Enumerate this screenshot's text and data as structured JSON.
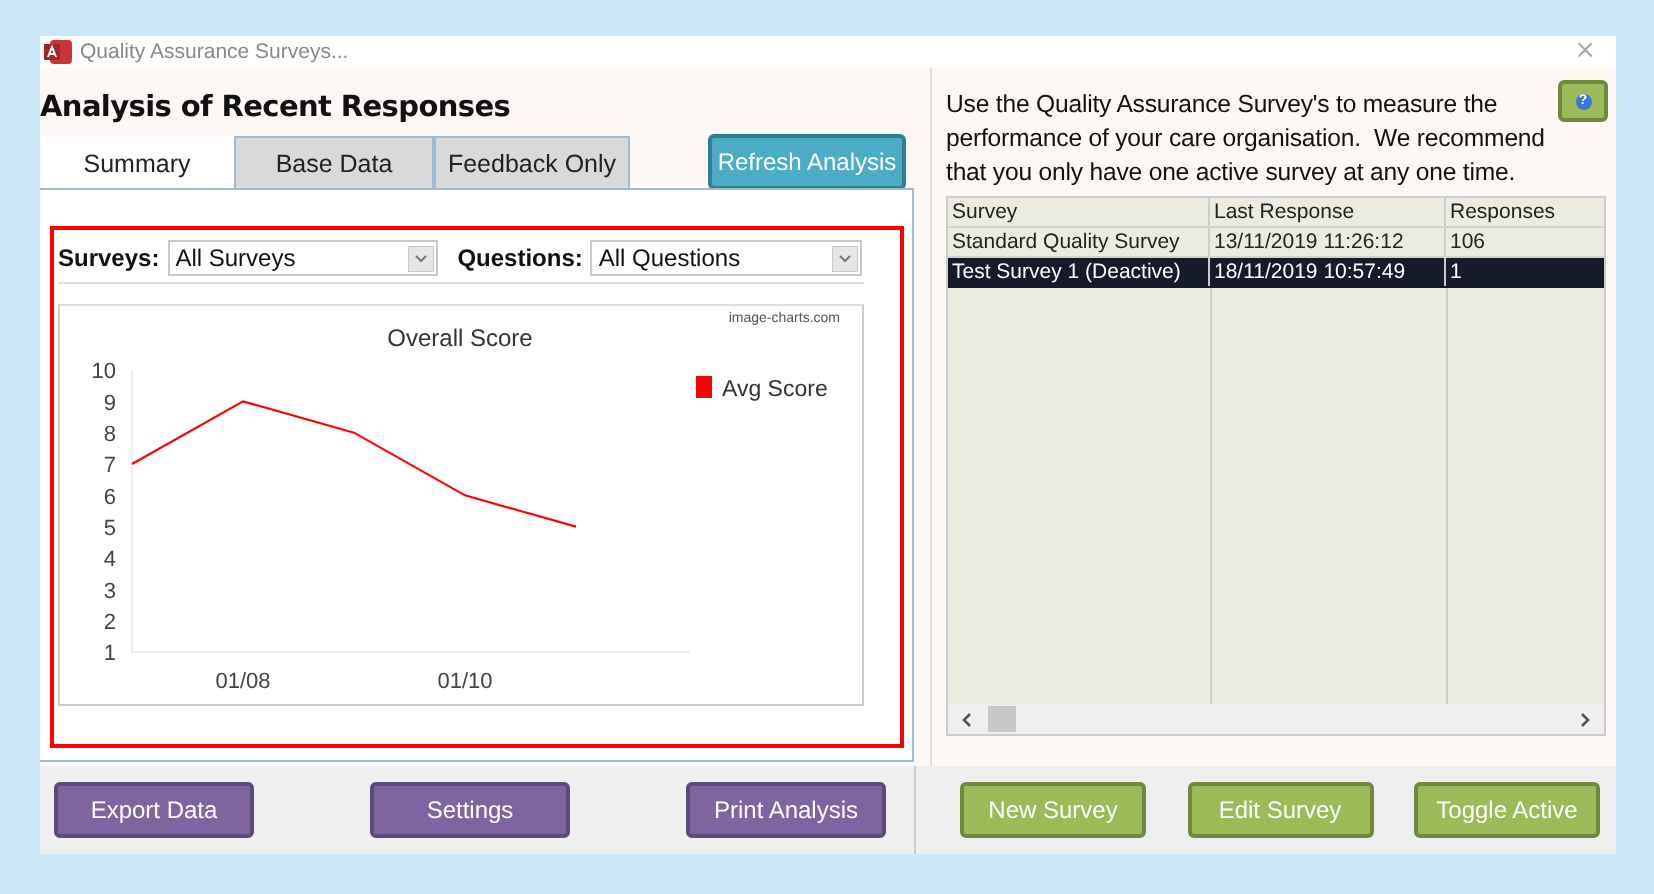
{
  "window": {
    "title": "Quality Assurance Surveys...",
    "close": "×"
  },
  "analysis": {
    "heading": "Analysis of Recent Responses",
    "tabs": [
      {
        "label": "Summary",
        "selected": true
      },
      {
        "label": "Base Data",
        "selected": false
      },
      {
        "label": "Feedback Only",
        "selected": false
      }
    ],
    "refresh_button": "Refresh Analysis",
    "filters": [
      {
        "label": "Surveys:",
        "value": "All Surveys"
      },
      {
        "label": "Questions:",
        "value": "All Questions"
      }
    ],
    "chart_credit": "image-charts.com",
    "chart_data": {
      "type": "line",
      "title": "Overall Score",
      "categories": [
        null,
        "01/08",
        null,
        "01/10",
        null
      ],
      "ylim": [
        1,
        10
      ],
      "yticks": [
        1,
        2,
        3,
        4,
        5,
        6,
        7,
        8,
        9,
        10
      ],
      "series": [
        {
          "name": "Avg Score",
          "color": "#ff0000",
          "values": [
            7,
            9,
            8,
            6,
            5
          ]
        }
      ]
    }
  },
  "info": {
    "text": "Use the Quality Assurance Survey's to measure the performance of your care organisation.  We recommend that you only have one active survey at any one time.",
    "help": "?"
  },
  "table": {
    "columns": [
      "Survey",
      "Last Response",
      "Responses"
    ],
    "rows": [
      {
        "cells": [
          "Standard Quality Survey",
          "13/11/2019 11:26:12",
          "106"
        ],
        "selected": false
      },
      {
        "cells": [
          "Test Survey 1 (Deactive)",
          "18/11/2019 10:57:49",
          "1"
        ],
        "selected": true
      }
    ]
  },
  "left_buttons": [
    "Export Data",
    "Settings",
    "Print Analysis"
  ],
  "right_buttons": [
    "New Survey",
    "Edit Survey",
    "Toggle Active"
  ]
}
